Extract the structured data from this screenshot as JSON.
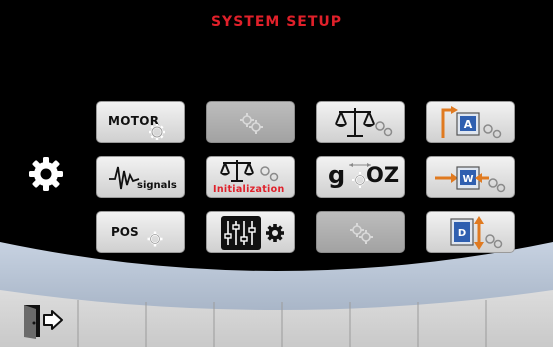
{
  "screen": {
    "title": "SYSTEM SETUP"
  },
  "buttons": {
    "motor": {
      "label": "MOTOR"
    },
    "signals": {
      "label": "signals"
    },
    "pos": {
      "label": "POS"
    },
    "initialization": {
      "label": "Initialization"
    },
    "units": {
      "label_g": "g",
      "label_oz": "OZ"
    }
  },
  "icons": {
    "settings_main": "gear-icon",
    "exit": "exit-door-icon",
    "scale": "balance-scale-icon",
    "equalizer": "slider-equalizer-icon",
    "signal": "waveform-icon",
    "cog_pair": "cog-pair-icon"
  },
  "colors": {
    "title": "#e0202a",
    "panel": "#000000",
    "button_face": "#e2e2e2",
    "button_disabled": "#b0b0b0",
    "footer": "#d6d6d6",
    "accent_blue": "#2f5fb0",
    "accent_orange": "#e07a20"
  }
}
